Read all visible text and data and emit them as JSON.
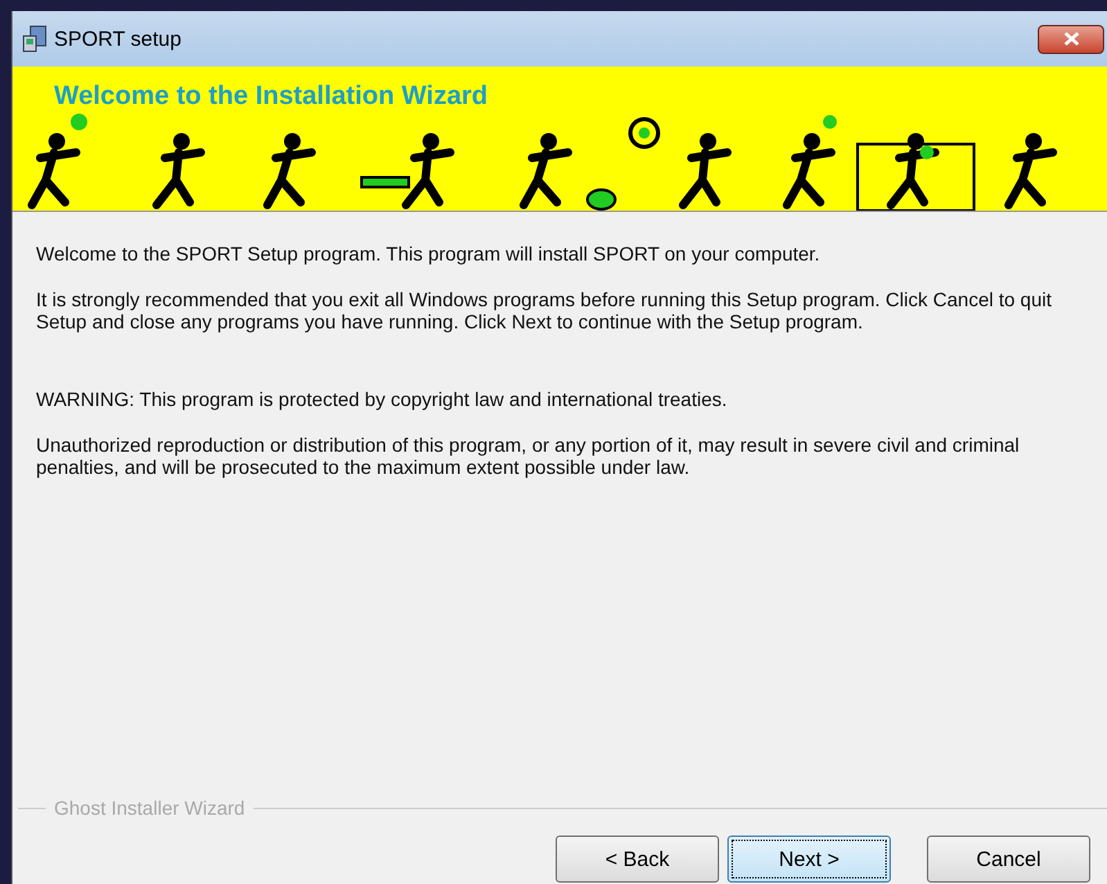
{
  "window": {
    "title": "SPORT setup"
  },
  "banner": {
    "title": "Welcome to the Installation Wizard"
  },
  "paragraphs": [
    "Welcome to the SPORT Setup program. This program will install SPORT on your computer.",
    "It is strongly recommended that you exit all Windows programs before running this Setup program. Click Cancel to quit Setup and close any programs you have running. Click Next to continue with the Setup program.",
    "WARNING: This program is protected by copyright law and international treaties.",
    "Unauthorized reproduction or distribution of this program, or any portion of it, may result in severe civil and criminal penalties, and will be prosecuted to the maximum extent possible under law."
  ],
  "footer_label": "Ghost Installer Wizard",
  "buttons": [
    {
      "label": "< Back",
      "default": false
    },
    {
      "label": "Next >",
      "default": true
    },
    {
      "label": "Cancel",
      "default": false
    }
  ]
}
